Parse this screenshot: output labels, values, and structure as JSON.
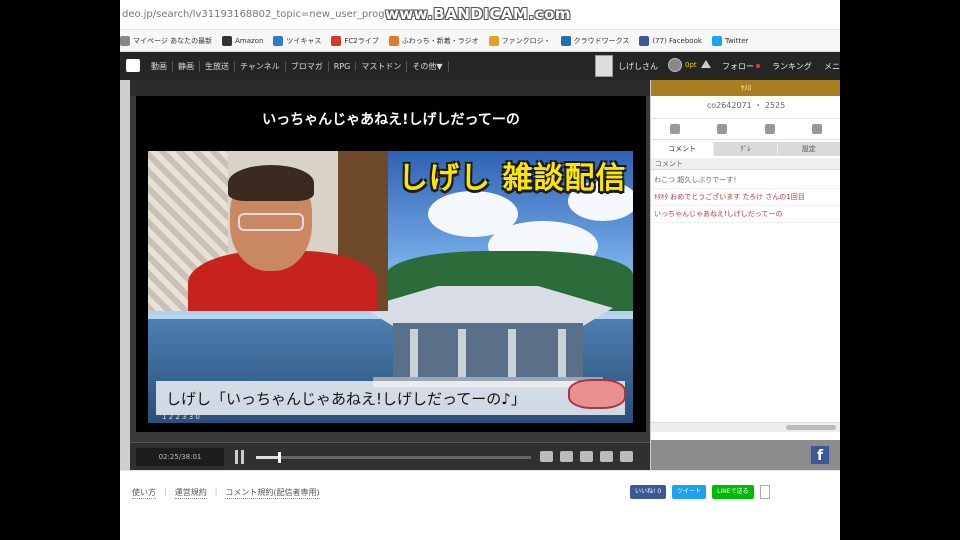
{
  "browser": {
    "url": "deo.jp/search/lv31193168802_topic=new_user_program_on",
    "recorder_watermark": "www.BANDICAM.com"
  },
  "bookmarks": [
    {
      "label": "マイページ あなたの最新",
      "color": "#888888"
    },
    {
      "label": "Amazon",
      "color": "#333333"
    },
    {
      "label": "ツイキャス",
      "color": "#2f7bd0"
    },
    {
      "label": "FC2ライブ",
      "color": "#d23b2b"
    },
    {
      "label": "ふわっち・新着・ラジオ",
      "color": "#e07b2a"
    },
    {
      "label": "ファンクロジ・",
      "color": "#e0a22a"
    },
    {
      "label": "クラウドワークス",
      "color": "#1f6fb5"
    },
    {
      "label": "(77) Facebook",
      "color": "#3b5998"
    },
    {
      "label": "Twitter",
      "color": "#1da1f2"
    }
  ],
  "nav": {
    "items": [
      "動画",
      "静画",
      "生放送",
      "チャンネル",
      "ブロマガ",
      "RPG",
      "マストドン",
      "その他▼"
    ],
    "username": "しげしさん",
    "points": "0pt",
    "follow": "フォロー",
    "ranking": "ランキング",
    "menu": "メニ"
  },
  "player": {
    "title": "いっちゃんじゃあねえ!しげしだってーの",
    "overlay_title": "しげし 雑談配信",
    "subtitle": "しげし「いっちゃんじゃあねえ!しげしだってーの♪」",
    "watermark": "1 2  2 3 3 0",
    "time": "02:25/38:01",
    "progress": 0.08
  },
  "panel": {
    "top_label": "ﾔﾒﾛ",
    "community": "co2642071 ・ 2525",
    "tabs": [
      "コメント",
      "ｸﾞﾚ",
      "設定"
    ],
    "list_header": "コメント",
    "comments": [
      {
        "text": "わこつ 超久しぶりでーす！",
        "color": "#666666"
      },
      {
        "text": "ｷﾀｷﾀ おめでとうございます たろけ さんの1回目",
        "color": "#d23232"
      },
      {
        "text": "いっちゃんじゃあねえ!しげしだってーの",
        "color": "#d23232"
      }
    ]
  },
  "footer": {
    "links": [
      "使い方",
      "運営規約",
      "コメント規約(配信者専用)"
    ],
    "share": [
      {
        "label": "いいね! 0",
        "color": "#3b5998"
      },
      {
        "label": "ツイート",
        "color": "#1da1f2"
      },
      {
        "label": "LINEで送る",
        "color": "#00b900"
      }
    ]
  }
}
